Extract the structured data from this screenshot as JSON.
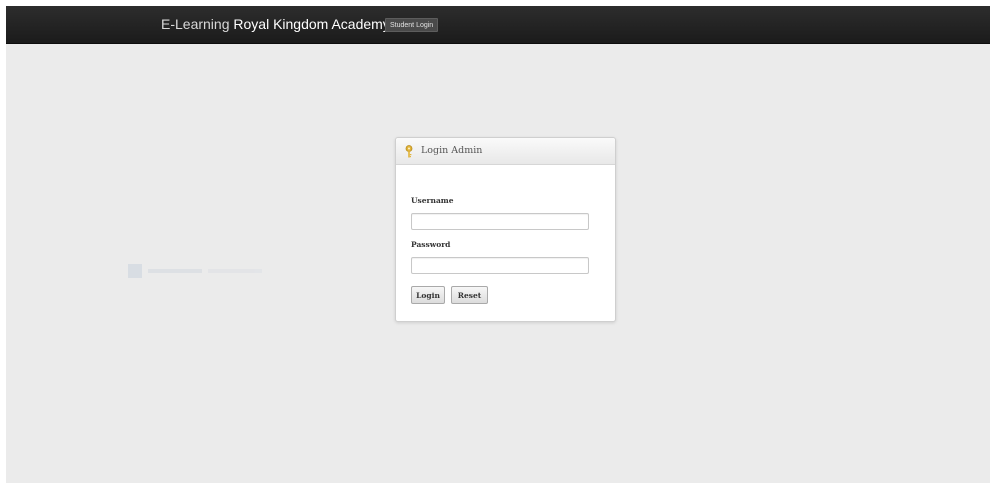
{
  "navbar": {
    "brand_prefix": "E-Learning ",
    "brand_name": "Royal Kingdom Academy",
    "student_login_label": "Student Login"
  },
  "login_panel": {
    "title": "Login Admin",
    "icon": "key-icon",
    "username_label": "Username",
    "username_value": "",
    "password_label": "Password",
    "password_value": "",
    "login_button_label": "Login",
    "reset_button_label": "Reset"
  },
  "colors": {
    "navbar_background": "#222222",
    "page_background": "#ebebeb",
    "panel_background": "#ffffff",
    "key_icon": "#e1b43a"
  }
}
